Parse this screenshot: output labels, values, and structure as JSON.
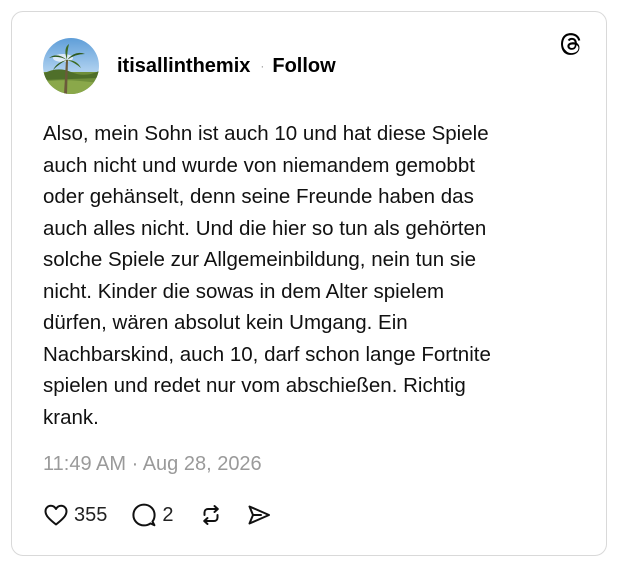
{
  "post": {
    "username": "itisallinthemix",
    "separator": "·",
    "follow_label": "Follow",
    "text": "Also, mein Sohn ist auch 10 und hat diese Spiele\nauch nicht und wurde von niemandem gemobbt\noder gehänselt,  denn seine Freunde haben das\nauch alles nicht. Und die hier so tun als gehörten\nsolche Spiele zur Allgemeinbildung,  nein tun sie\nnicht. Kinder die sowas in dem Alter spielem\ndürfen, wären absolut kein Umgang. Ein\nNachbarskind, auch 10, darf schon lange Fortnite\nspielen und redet nur vom abschießen. Richtig\nkrank.",
    "timestamp": "11:49 AM · Aug 28, 2026"
  },
  "actions": {
    "like_count": "355",
    "reply_count": "2"
  },
  "icons": {
    "logo": "threads-logo-icon",
    "like": "heart-icon",
    "reply": "comment-bubble-icon",
    "repost": "repost-arrows-icon",
    "share": "send-icon"
  },
  "colors": {
    "text": "#111111",
    "muted": "#9a9a9a",
    "border": "#d9d9d9"
  }
}
